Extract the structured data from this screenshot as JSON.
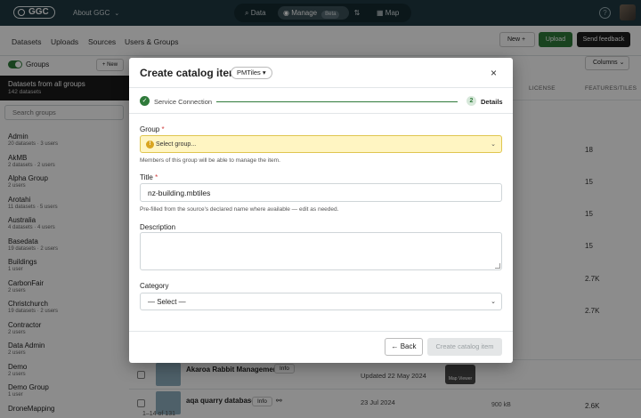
{
  "topbar": {
    "logo": "GGC",
    "about": "About GGC",
    "nav": {
      "data": "Data",
      "manage": "Manage",
      "beta": "Beta",
      "map": "Map"
    },
    "help": "?"
  },
  "subnav": {
    "items": [
      "Datasets",
      "Uploads",
      "Sources",
      "Users & Groups"
    ],
    "new_button": "New",
    "upload_button": "Upload",
    "feedback_button": "Send feedback"
  },
  "groups_panel": {
    "label": "Groups",
    "new_button": "New",
    "all_title": "Datasets from all groups",
    "all_count": "142 datasets",
    "search_placeholder": "Search groups",
    "groups": [
      {
        "name": "Admin",
        "meta": "20 datasets · 3 users"
      },
      {
        "name": "AkMB",
        "meta": "2 datasets · 2 users"
      },
      {
        "name": "Alpha Group",
        "meta": "2 users"
      },
      {
        "name": "Arotahi",
        "meta": "11 datasets · 5 users"
      },
      {
        "name": "Australia",
        "meta": "4 datasets · 4 users"
      },
      {
        "name": "Basedata",
        "meta": "19 datasets · 2 users"
      },
      {
        "name": "Buildings",
        "meta": "1 user"
      },
      {
        "name": "CarbonFair",
        "meta": "2 users"
      },
      {
        "name": "Christchurch",
        "meta": "19 datasets · 2 users"
      },
      {
        "name": "Contractor",
        "meta": "2 users"
      },
      {
        "name": "Data Admin",
        "meta": "2 users"
      },
      {
        "name": "Demo",
        "meta": "2 users"
      },
      {
        "name": "Demo Group",
        "meta": "1 user"
      },
      {
        "name": "DroneMapping",
        "meta": ""
      }
    ]
  },
  "table": {
    "columns_button": "Columns",
    "headers": {
      "license": "LICENSE",
      "features": "FEATURES/TILES"
    },
    "features_values": [
      "18",
      "15",
      "15",
      "15",
      "2.7K",
      "2.7K"
    ],
    "rows": [
      {
        "title": "Akaroa Rabbit Management",
        "info": "Info",
        "date": "Updated 22 May 2024",
        "viewer": "Map Viewer"
      },
      {
        "title": "aqa quarry database",
        "info": "Info",
        "date": "23 Jul 2024",
        "size": "900 kB",
        "features": "2.6K"
      }
    ],
    "footer": "1–14 of 131"
  },
  "modal": {
    "title": "Create catalog item:",
    "type_chip": "PMTiles ▾",
    "close": "×",
    "steps": [
      {
        "num": "✓",
        "label": "Service Connection"
      },
      {
        "num": "2",
        "label": "Details"
      }
    ],
    "group": {
      "label": "Group",
      "required": "*",
      "placeholder": "Select group...",
      "help": "Members of this group will be able to manage the item."
    },
    "title_field": {
      "label": "Title",
      "required": "*",
      "value": "nz-building.mbtiles",
      "help": "Pre-filled from the source's declared name where available — edit as needed."
    },
    "description": {
      "label": "Description",
      "value": ""
    },
    "category": {
      "label": "Category",
      "selected": "— Select —"
    },
    "back_button": "← Back",
    "create_button": "Create catalog item"
  },
  "colors": {
    "topbar": "#1f3942",
    "accent_green": "#2f7a3a",
    "warning_bg": "#fff5c2"
  }
}
